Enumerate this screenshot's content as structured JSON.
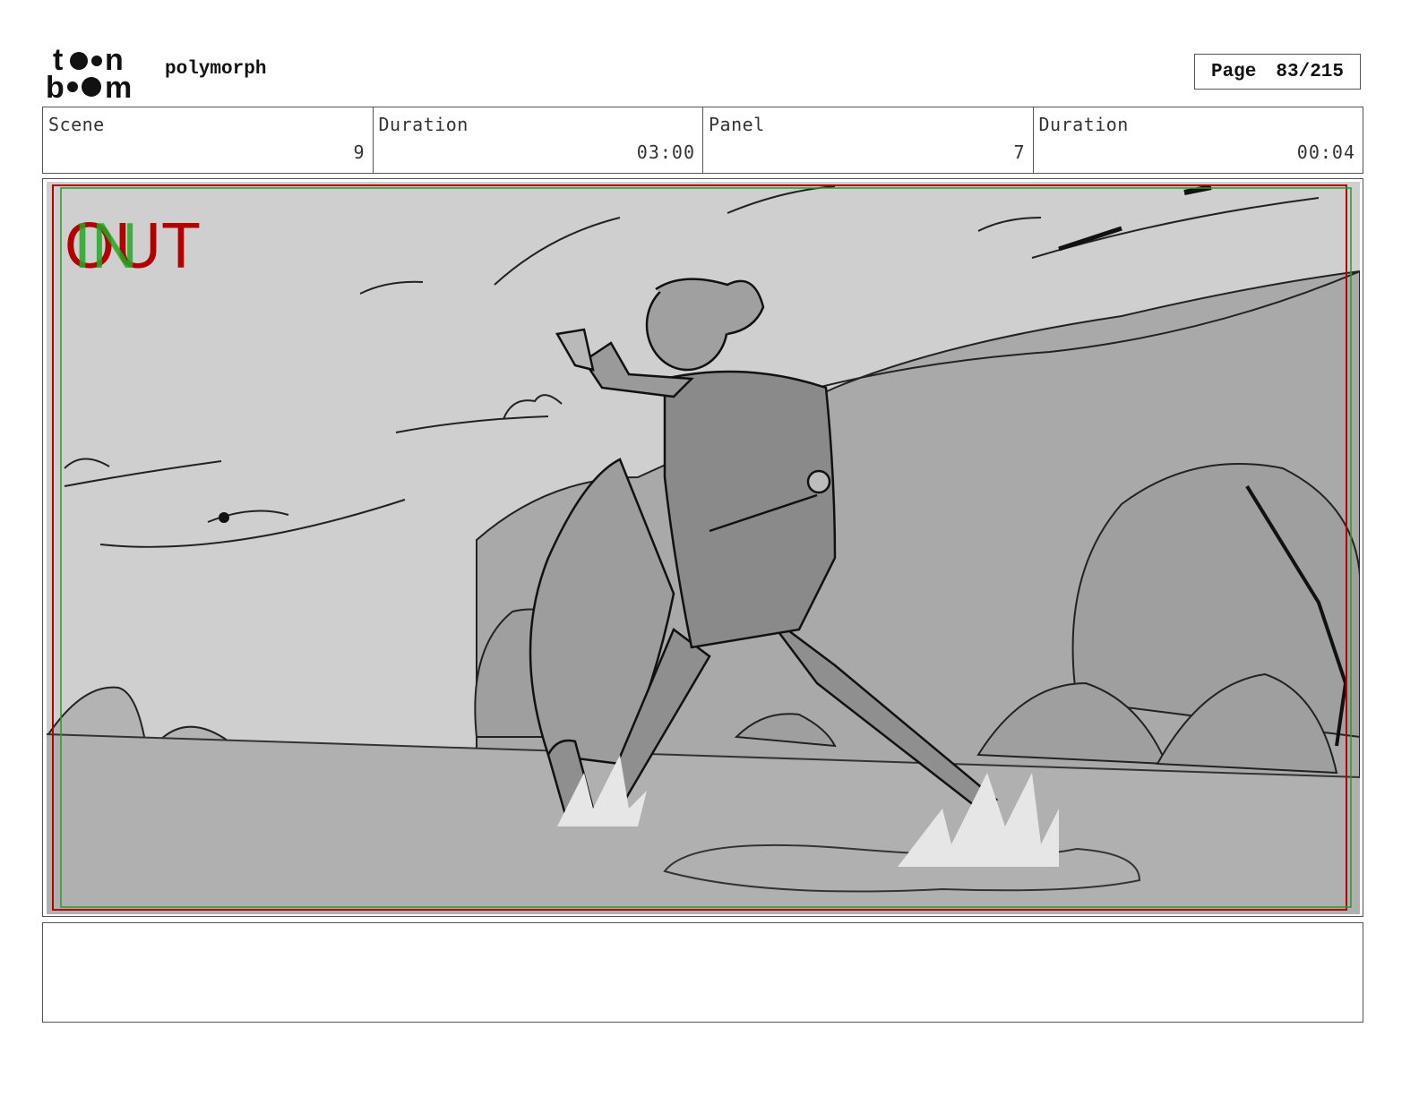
{
  "header": {
    "logo_text": "toon boom",
    "project_name": "polymorph",
    "page_label": "Page",
    "page_value": "83/215"
  },
  "info": {
    "scene_label": "Scene",
    "scene_value": "9",
    "scene_duration_label": "Duration",
    "scene_duration_value": "03:00",
    "panel_label": "Panel",
    "panel_value": "7",
    "panel_duration_label": "Duration",
    "panel_duration_value": "00:04"
  },
  "panel": {
    "in_label": "IN",
    "out_label": "OUT",
    "in_color": "#22aa22",
    "out_color": "#b30000"
  },
  "notes": {
    "text": ""
  }
}
